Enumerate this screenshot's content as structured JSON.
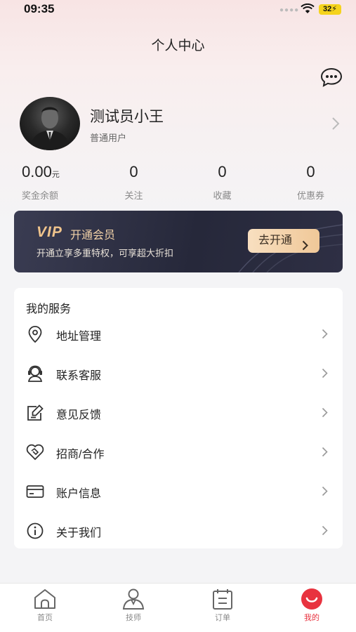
{
  "status_bar": {
    "time": "09:35",
    "battery": "32"
  },
  "header": {
    "title": "个人中心"
  },
  "icons": {
    "message": "chat-bubble-icon",
    "chevron": "chevron-right-icon"
  },
  "profile": {
    "name": "测试员小王",
    "level": "普通用户"
  },
  "stats": {
    "balance": {
      "value": "0.00",
      "unit": "元",
      "label": "奖金余额"
    },
    "follow": {
      "value": "0",
      "label": "关注"
    },
    "favorites": {
      "value": "0",
      "label": "收藏"
    },
    "coupons": {
      "value": "0",
      "label": "优惠券"
    }
  },
  "vip": {
    "logo": "VIP",
    "title": "开通会员",
    "desc": "开通立享多重特权，可享超大折扣",
    "button": "去开通"
  },
  "services": {
    "title": "我的服务",
    "items": [
      {
        "label": "地址管理",
        "icon": "location-pin-icon"
      },
      {
        "label": "联系客服",
        "icon": "customer-service-icon"
      },
      {
        "label": "意见反馈",
        "icon": "feedback-icon"
      },
      {
        "label": "招商/合作",
        "icon": "handshake-icon"
      },
      {
        "label": "账户信息",
        "icon": "card-icon"
      },
      {
        "label": "关于我们",
        "icon": "info-icon"
      }
    ]
  },
  "tabbar": {
    "tabs": [
      {
        "label": "首页",
        "icon": "home-icon"
      },
      {
        "label": "技师",
        "icon": "technician-icon"
      },
      {
        "label": "订单",
        "icon": "order-icon"
      },
      {
        "label": "我的",
        "icon": "profile-smile-icon",
        "active": true
      }
    ]
  },
  "colors": {
    "accent": "#e8333f",
    "vip_gold": "#f0c48c",
    "vip_bg": "#2e2f44"
  }
}
